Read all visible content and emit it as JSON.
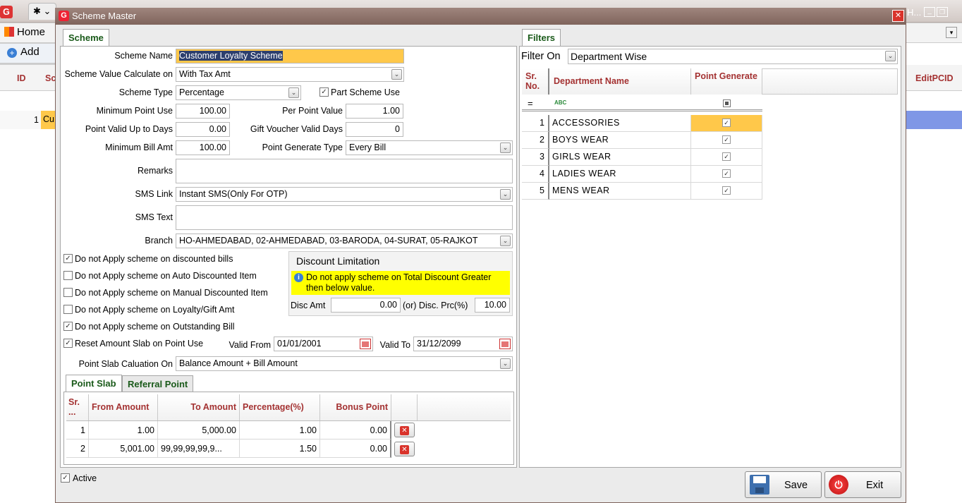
{
  "background_app": {
    "home_label": "Home",
    "add_label": "Add",
    "col_id": "ID",
    "col_sc": "Sc",
    "col_edit": "EditPCID",
    "row_id": "1",
    "row_text": "Cu",
    "window_hint": "H..."
  },
  "dialog": {
    "title": "Scheme Master",
    "close_glyph": "✕"
  },
  "tabs": {
    "scheme": "Scheme",
    "filters": "Filters",
    "point_slab": "Point Slab",
    "referral_point": "Referral Point"
  },
  "form": {
    "scheme_name_label": "Scheme Name",
    "scheme_name": "Customer Loyalty Scheme",
    "calc_on_label": "Scheme Value Calculate on",
    "calc_on": "With Tax Amt",
    "scheme_type_label": "Scheme Type",
    "scheme_type": "Percentage",
    "part_scheme_label": "Part Scheme Use",
    "min_point_label": "Minimum Point Use",
    "min_point": "100.00",
    "per_point_label": "Per Point Value",
    "per_point": "1.00",
    "valid_days_label": "Point Valid Up to Days",
    "valid_days": "0.00",
    "gift_days_label": "Gift Voucher Valid Days",
    "gift_days": "0",
    "min_bill_label": "Minimum Bill Amt",
    "min_bill": "100.00",
    "gen_type_label": "Point Generate Type",
    "gen_type": "Every Bill",
    "remarks_label": "Remarks",
    "remarks": "",
    "sms_link_label": "SMS Link",
    "sms_link": "Instant SMS(Only For OTP)",
    "sms_text_label": "SMS Text",
    "sms_text": "",
    "branch_label": "Branch",
    "branch": "HO-AHMEDABAD, 02-AHMEDABAD, 03-BARODA, 04-SURAT, 05-RAJKOT",
    "options": [
      {
        "label": "Do not Apply scheme on discounted bills",
        "checked": true
      },
      {
        "label": "Do not Apply scheme on Auto Discounted Item",
        "checked": false
      },
      {
        "label": "Do not Apply scheme on Manual Discounted Item",
        "checked": false
      },
      {
        "label": "Do not Apply scheme on Loyalty/Gift Amt",
        "checked": false
      },
      {
        "label": "Do not Apply scheme on Outstanding Bill",
        "checked": true
      },
      {
        "label": "Reset Amount Slab on Point Use",
        "checked": true
      }
    ],
    "valid_from_label": "Valid From",
    "valid_from": "01/01/2001",
    "valid_to_label": "Valid To",
    "valid_to": "31/12/2099",
    "slab_calc_label": "Point Slab Caluation On",
    "slab_calc": "Balance Amount  + Bill Amount",
    "active_label": "Active"
  },
  "discount": {
    "title": "Discount Limitation",
    "note": "Do not apply scheme on Total Discount Greater then below value.",
    "disc_amt_label": "Disc Amt",
    "disc_amt": "0.00",
    "disc_prc_label": "(or) Disc. Prc(%)",
    "disc_prc": "10.00"
  },
  "slab_grid": {
    "headers": {
      "sr": "Sr. ...",
      "from": "From Amount",
      "to": "To Amount",
      "pct": "Percentage(%)",
      "bonus": "Bonus Point"
    },
    "rows": [
      {
        "sr": "1",
        "from": "1.00",
        "to": "5,000.00",
        "pct": "1.00",
        "bonus": "0.00"
      },
      {
        "sr": "2",
        "from": "5,001.00",
        "to": "99,99,99,99,9...",
        "pct": "1.50",
        "bonus": "0.00"
      }
    ]
  },
  "filters": {
    "filter_on_label": "Filter On",
    "filter_on": "Department Wise",
    "headers": {
      "sr": "Sr. No.",
      "dept": "Department Name",
      "gen": "Point Generate"
    },
    "rows": [
      {
        "sr": "1",
        "name": "ACCESSORIES"
      },
      {
        "sr": "2",
        "name": "BOYS WEAR"
      },
      {
        "sr": "3",
        "name": "GIRLS WEAR"
      },
      {
        "sr": "4",
        "name": "LADIES WEAR"
      },
      {
        "sr": "5",
        "name": "MENS WEAR"
      }
    ]
  },
  "buttons": {
    "save": "Save",
    "exit": "Exit"
  },
  "colors": {
    "accent": "#a43232",
    "highlight": "#ffc84a",
    "note_bg": "#ffff00",
    "title_bar": "#8c6f66"
  }
}
